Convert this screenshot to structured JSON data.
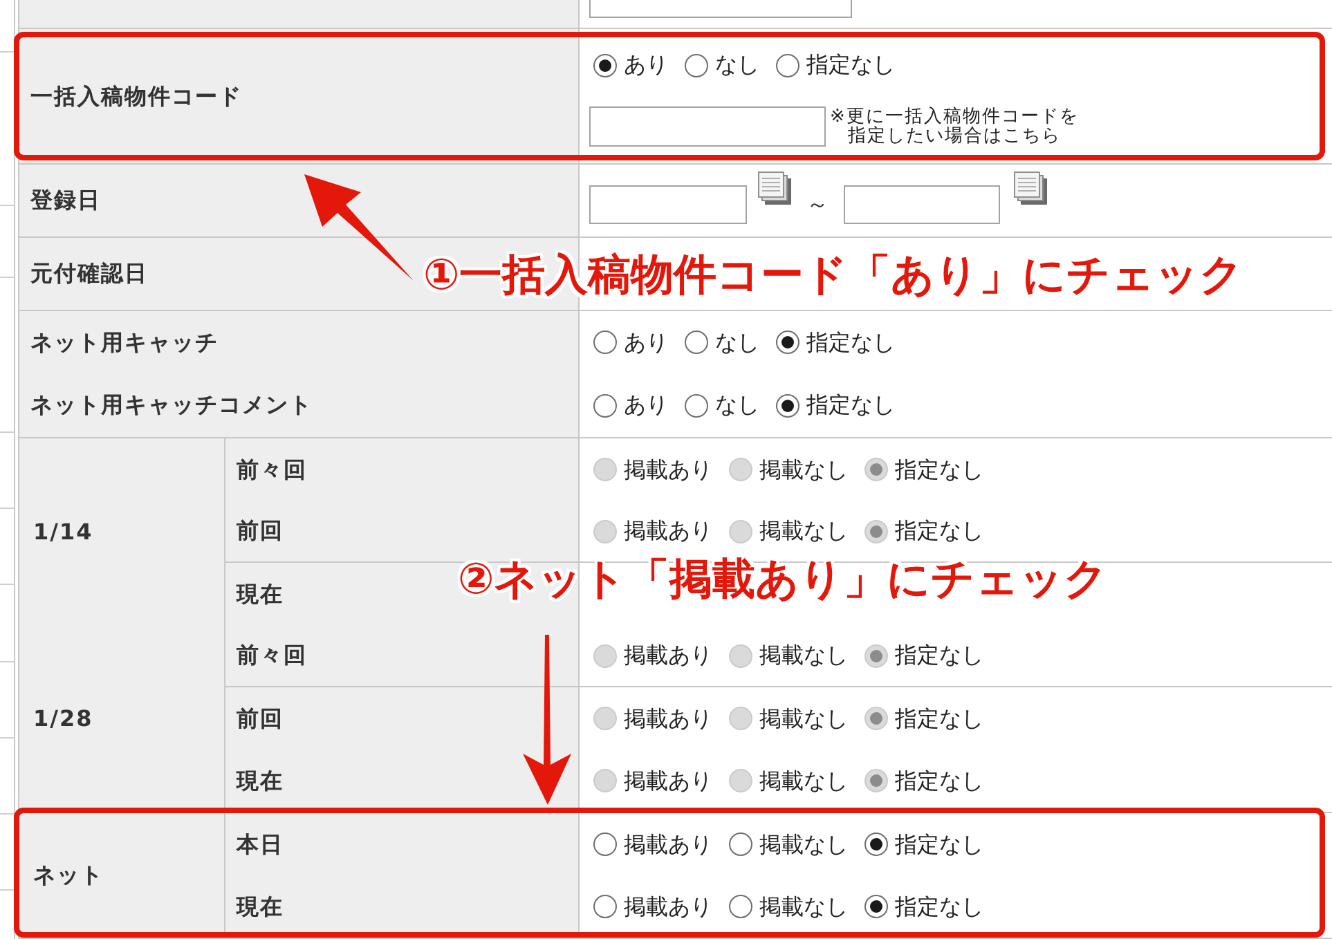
{
  "form": {
    "rows": [
      {
        "kind": "input",
        "highlighted": false
      },
      {
        "kind": "radio_input",
        "label": "一括入稿物件コード",
        "highlighted": true,
        "options": [
          {
            "label": "あり",
            "selected": true
          },
          {
            "label": "なし",
            "selected": false
          },
          {
            "label": "指定なし",
            "selected": false
          }
        ],
        "note": [
          "※更に一括入稿物件コードを",
          "指定したい場合はこちら"
        ]
      },
      {
        "kind": "date_range",
        "label": "登録日",
        "highlighted": false,
        "separator": "～"
      },
      {
        "kind": "date_range",
        "label": "元付確認日",
        "highlighted": false
      },
      {
        "kind": "radio_pairs",
        "highlighted": false,
        "items": [
          {
            "label": "ネット用キャッチ",
            "options": [
              {
                "label": "あり",
                "selected": false
              },
              {
                "label": "なし",
                "selected": false
              },
              {
                "label": "指定なし",
                "selected": true
              }
            ]
          },
          {
            "label": "ネット用キャッチコメント",
            "options": [
              {
                "label": "あり",
                "selected": false
              },
              {
                "label": "なし",
                "selected": false
              },
              {
                "label": "指定なし",
                "selected": true
              }
            ]
          }
        ]
      },
      {
        "kind": "grouped",
        "highlighted": false,
        "groups": [
          {
            "label": "1/14",
            "items": [
              {
                "label": "前々回",
                "disabled": true,
                "options": [
                  {
                    "label": "掲載あり",
                    "selected": false
                  },
                  {
                    "label": "掲載なし",
                    "selected": false
                  },
                  {
                    "label": "指定なし",
                    "selected": true
                  }
                ]
              },
              {
                "label": "前回",
                "disabled": true,
                "options": [
                  {
                    "label": "掲載あり",
                    "selected": false
                  },
                  {
                    "label": "掲載なし",
                    "selected": false
                  },
                  {
                    "label": "指定なし",
                    "selected": true
                  }
                ]
              },
              {
                "label": "現在"
              }
            ]
          },
          {
            "label": "1/28",
            "items": [
              {
                "label": "前々回",
                "disabled": true,
                "options": [
                  {
                    "label": "掲載あり",
                    "selected": false
                  },
                  {
                    "label": "掲載なし",
                    "selected": false
                  },
                  {
                    "label": "指定なし",
                    "selected": true
                  }
                ]
              },
              {
                "label": "前回",
                "disabled": true,
                "options": [
                  {
                    "label": "掲載あり",
                    "selected": false
                  },
                  {
                    "label": "掲載なし",
                    "selected": false
                  },
                  {
                    "label": "指定なし",
                    "selected": true
                  }
                ]
              },
              {
                "label": "現在",
                "disabled": true,
                "options": [
                  {
                    "label": "掲載あり",
                    "selected": false
                  },
                  {
                    "label": "掲載なし",
                    "selected": false
                  },
                  {
                    "label": "指定なし",
                    "selected": true
                  }
                ]
              }
            ]
          }
        ]
      },
      {
        "kind": "grouped",
        "highlighted": true,
        "groups": [
          {
            "label": "ネット",
            "items": [
              {
                "label": "本日",
                "disabled": false,
                "options": [
                  {
                    "label": "掲載あり",
                    "selected": false
                  },
                  {
                    "label": "掲載なし",
                    "selected": false
                  },
                  {
                    "label": "指定なし",
                    "selected": true
                  }
                ]
              },
              {
                "label": "現在",
                "disabled": false,
                "options": [
                  {
                    "label": "掲載あり",
                    "selected": false
                  },
                  {
                    "label": "掲載なし",
                    "selected": false
                  },
                  {
                    "label": "指定なし",
                    "selected": true
                  }
                ]
              }
            ]
          }
        ]
      }
    ]
  },
  "annotations": [
    {
      "text": "①一括入稿物件コード「あり」にチェック"
    },
    {
      "text": "②ネット「掲載あり」にチェック"
    }
  ]
}
